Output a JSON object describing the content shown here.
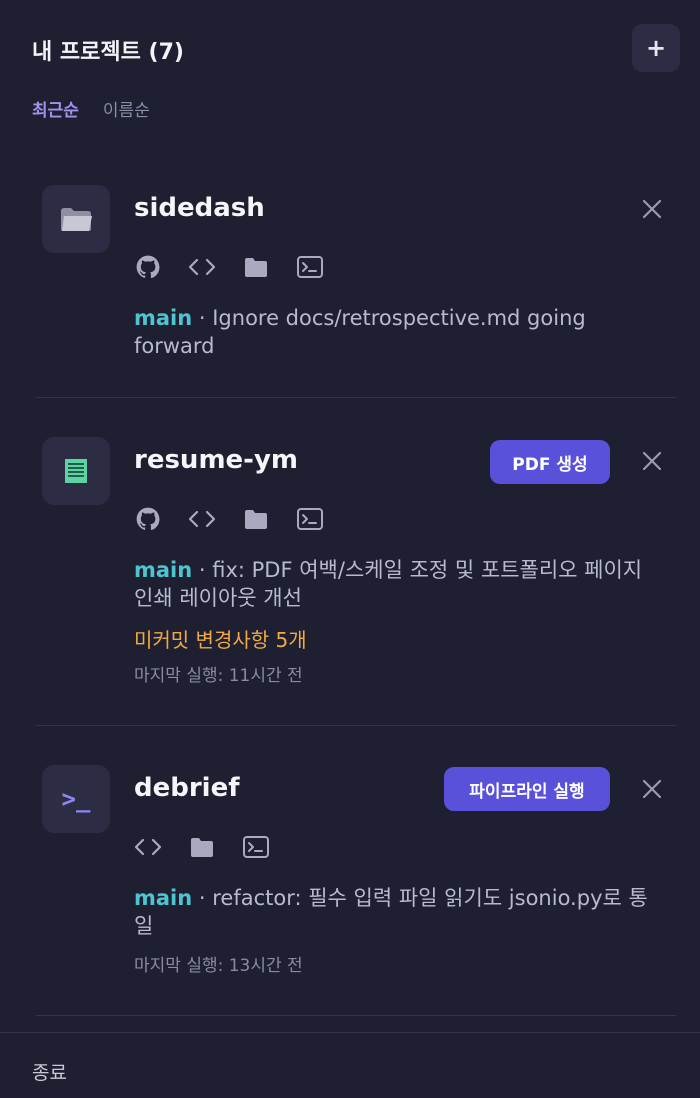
{
  "header": {
    "title": "내 프로젝트 (7)",
    "add_label": "+"
  },
  "sort": {
    "recent": "최근순",
    "name": "이름순"
  },
  "projects": [
    {
      "name": "sidedash",
      "icon": "folder-icon",
      "branch": "main",
      "separator": " · ",
      "commit": "Ignore docs/retrospective.md going forward"
    },
    {
      "name": "resume-ym",
      "icon": "document-icon",
      "action": "PDF 생성",
      "branch": "main",
      "separator": " · ",
      "commit": "fix: PDF 여백/스케일 조정 및 포트폴리오 페이지 인쇄 레이아웃 개선",
      "uncommitted": "미커밋 변경사항 5개",
      "last_run": "마지막 실행: 11시간 전"
    },
    {
      "name": "debrief",
      "icon": "terminal-prompt-icon",
      "icon_text": ">_",
      "action": "파이프라인 실행",
      "branch": "main",
      "separator": " · ",
      "commit": "refactor: 필수 입력 파일 읽기도 jsonio.py로 통일",
      "last_run": "마지막 실행: 13시간 전"
    }
  ],
  "footer": {
    "exit_label": "종료"
  },
  "colors": {
    "background": "#1e1f30",
    "accent": "#5a51db",
    "branch": "#4fc4d1",
    "warning": "#efaa45",
    "active_sort": "#9f93ee"
  }
}
